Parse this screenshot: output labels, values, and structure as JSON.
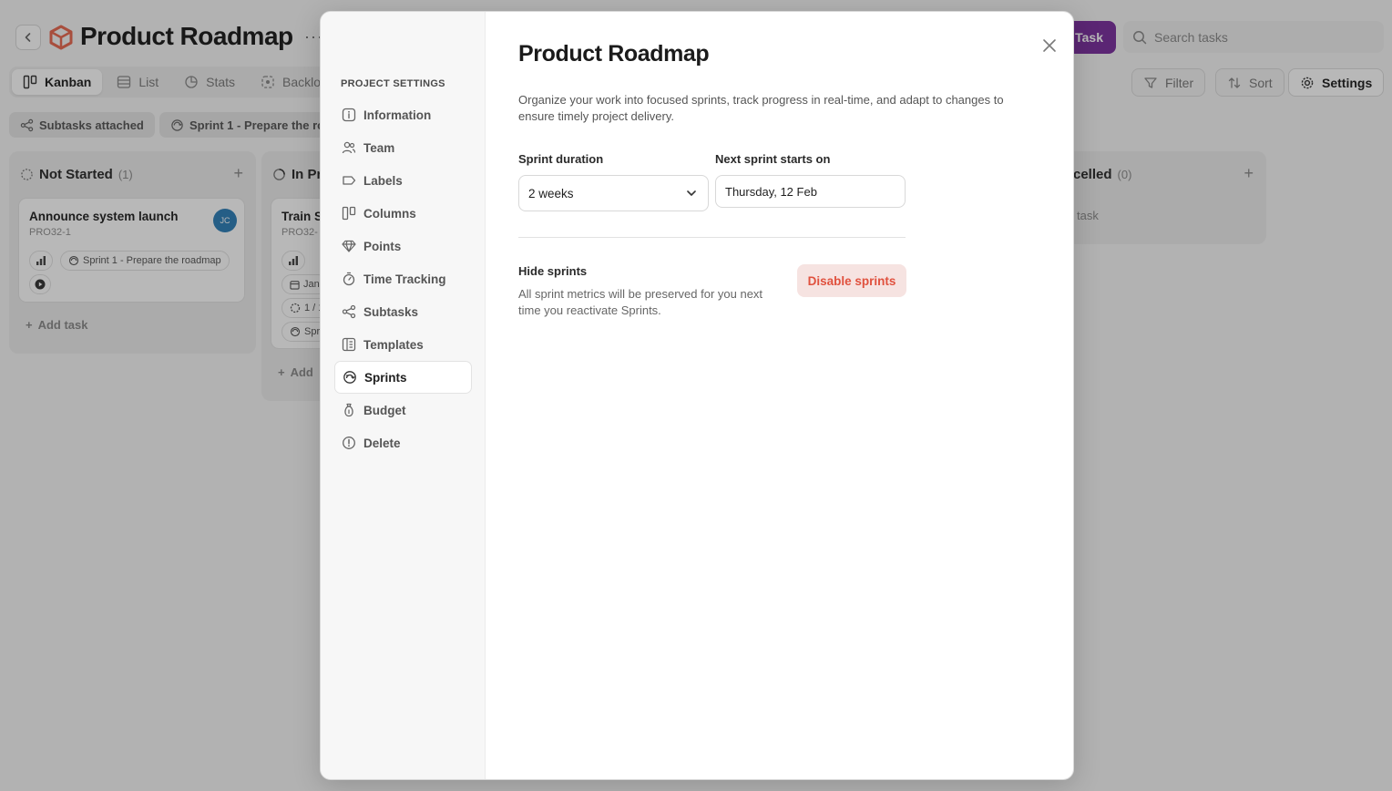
{
  "header": {
    "title": "Product Roadmap",
    "more": "···",
    "add_task_label": "Task",
    "search_placeholder": "Search tasks"
  },
  "views": [
    {
      "label": "Kanban",
      "icon": "kanban-icon",
      "active": true
    },
    {
      "label": "List",
      "icon": "list-icon"
    },
    {
      "label": "Stats",
      "icon": "stats-icon"
    },
    {
      "label": "Backlo",
      "icon": "backlog-icon"
    }
  ],
  "toolbar": {
    "filter_label": "Filter",
    "sort_label": "Sort",
    "settings_label": "Settings"
  },
  "chips": {
    "subtasks": "Subtasks attached",
    "sprint": "Sprint 1 - Prepare the ro"
  },
  "columns": {
    "not_started": {
      "title": "Not Started",
      "count": "(1)",
      "card": {
        "title": "Announce system launch",
        "id": "PRO32-1",
        "avatar": "JC",
        "sprint_chip": "Sprint 1 - Prepare the roadmap"
      },
      "add_task": "Add task"
    },
    "in_progress": {
      "title": "In Pr",
      "card": {
        "title": "Train S",
        "id": "PRO32-",
        "date_chip": "Jan",
        "progress_chip": "1 / 1",
        "sprint_chip": "Spr"
      },
      "add_task": "Add"
    },
    "cancelled": {
      "title": "celled",
      "count": "(0)",
      "add_task": "task"
    }
  },
  "modal": {
    "sidebar_heading": "PROJECT SETTINGS",
    "sidebar_items": [
      {
        "label": "Information",
        "icon": "info-icon"
      },
      {
        "label": "Team",
        "icon": "team-icon"
      },
      {
        "label": "Labels",
        "icon": "label-icon"
      },
      {
        "label": "Columns",
        "icon": "columns-icon"
      },
      {
        "label": "Points",
        "icon": "diamond-icon"
      },
      {
        "label": "Time Tracking",
        "icon": "stopwatch-icon"
      },
      {
        "label": "Subtasks",
        "icon": "subtasks-icon"
      },
      {
        "label": "Templates",
        "icon": "templates-icon"
      },
      {
        "label": "Sprints",
        "icon": "sprint-icon",
        "active": true
      },
      {
        "label": "Budget",
        "icon": "money-bag-icon"
      },
      {
        "label": "Delete",
        "icon": "alert-circle-icon"
      }
    ],
    "title": "Product Roadmap",
    "description": "Organize your work into focused sprints, track progress in real-time, and adapt to changes to ensure timely project delivery.",
    "sprint_duration_label": "Sprint duration",
    "sprint_duration_value": "2 weeks",
    "next_sprint_label": "Next sprint starts on",
    "next_sprint_value": "Thursday, 12 Feb",
    "hide_title": "Hide sprints",
    "hide_description": "All sprint metrics will be preserved for you next time you reactivate Sprints.",
    "disable_label": "Disable sprints"
  },
  "colors": {
    "accent_purple": "#7a2e9e",
    "danger": "#e0513e",
    "danger_bg": "#f6e3e1",
    "avatar_blue": "#2d7fb8"
  }
}
